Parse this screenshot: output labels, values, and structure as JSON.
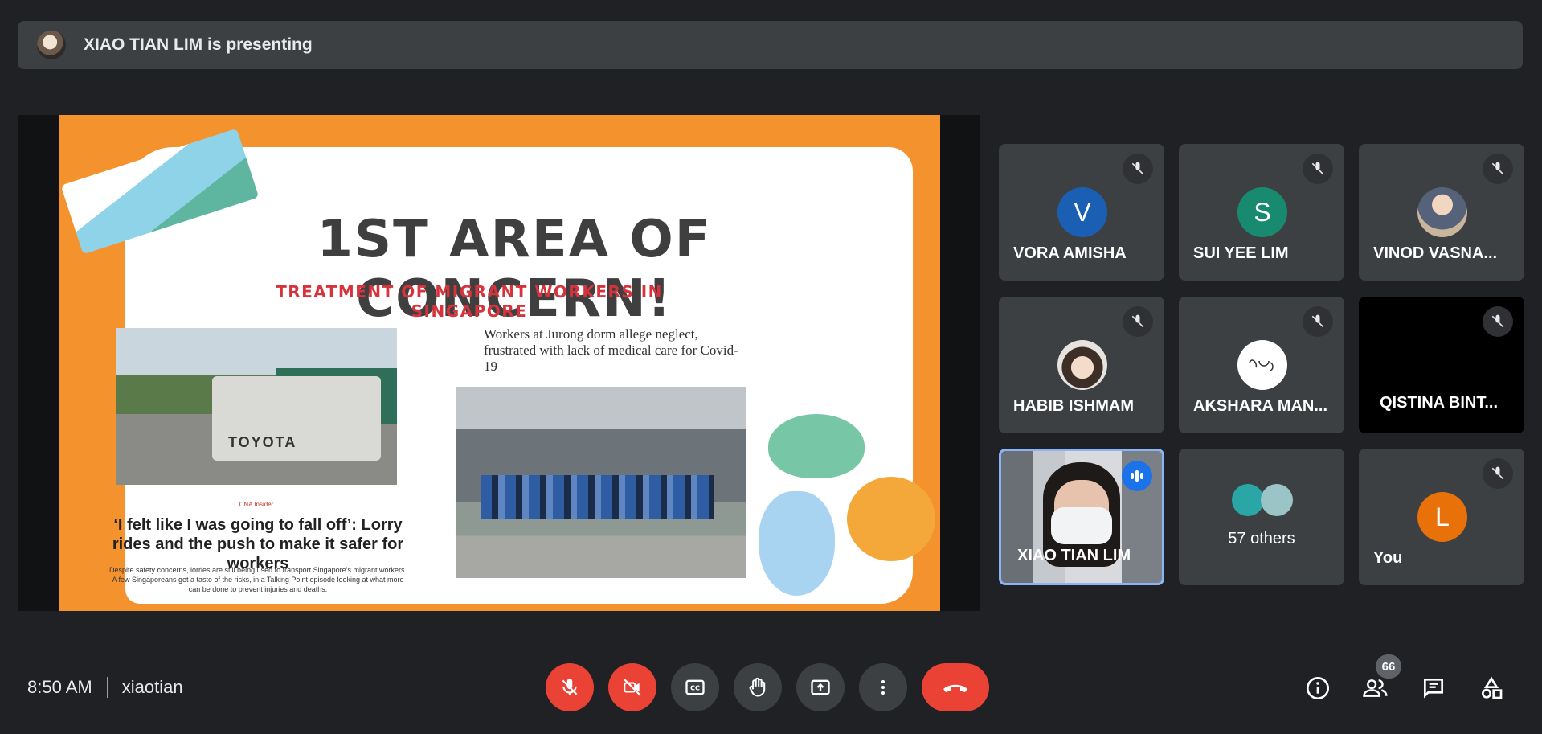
{
  "banner": {
    "presenting_text": "XIAO TIAN LIM is presenting"
  },
  "slide": {
    "title": "1ST AREA OF CONCERN!",
    "subtitle": "TREATMENT OF MIGRANT WORKERS IN SINGAPORE",
    "truck_text": "TOYOTA",
    "source": "CNA Insider",
    "headline": "‘I felt like I was going to fall off’: Lorry rides and the push to make it safer for workers",
    "blurb": "Despite safety concerns, lorries are still being used to transport Singapore’s migrant workers. A few Singaporeans get a taste of the risks, in a Talking Point episode looking at what more can be done to prevent injuries and deaths.",
    "article_title": "Workers at Jurong dorm allege neglect, frustrated with lack of medical care for Covid-19"
  },
  "participants": [
    {
      "name": "VORA AMISHA",
      "initial": "V",
      "color": "#1a5fb4",
      "muted": true
    },
    {
      "name": "SUI YEE LIM",
      "initial": "S",
      "color": "#188a6f",
      "muted": true
    },
    {
      "name": "VINOD VASNA...",
      "initial": "",
      "color": "#b8c4cc",
      "muted": true
    },
    {
      "name": "HABIB ISHMAM",
      "initial": "",
      "color": "#e9d7c4",
      "muted": true
    },
    {
      "name": "AKSHARA MAN...",
      "initial": "",
      "color": "#ffffff",
      "muted": true
    },
    {
      "name": "QISTINA BINT...",
      "initial": "",
      "color": "#000000",
      "muted": true
    },
    {
      "name": "XIAO TIAN LIM",
      "initial": "",
      "color": "#8a8f94",
      "muted": false,
      "speaking": true
    },
    {
      "name": "57 others",
      "initial": "",
      "color": "#3c4043",
      "muted": false
    },
    {
      "name": "You",
      "initial": "L",
      "color": "#e8710a",
      "muted": true
    }
  ],
  "footer": {
    "time": "8:50 AM",
    "meeting_code": "xiaotian",
    "people_count": "66"
  }
}
